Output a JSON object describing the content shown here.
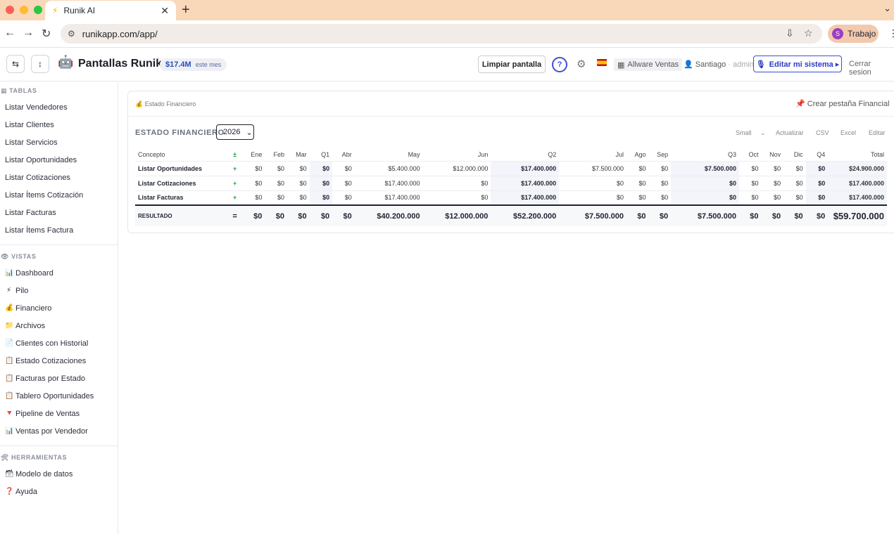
{
  "browser": {
    "tab_title": "Runik AI",
    "url": "runikapp.com/app/",
    "profile_initial": "S",
    "profile_label": "Trabajo"
  },
  "header": {
    "brand": "Pantallas Runik",
    "kpi_value": "$17.4M",
    "kpi_label": "este mes",
    "clear_label": "Limpiar pantalla",
    "help_label": "?",
    "company": "Allware Ventas",
    "user_name": "Santiago",
    "user_role": "· admin",
    "edit_label": "Editar mi sistema ▸",
    "logout_label": "Cerrar sesion"
  },
  "sidebar": {
    "tables_title": "TABLAS",
    "tables": [
      "Listar Vendedores",
      "Listar Clientes",
      "Listar Servicios",
      "Listar Oportunidades",
      "Listar Cotizaciones",
      "Listar Ítems Cotización",
      "Listar Facturas",
      "Listar Ítems Factura"
    ],
    "views_title": "VISTAS",
    "views": [
      {
        "label": "Dashboard",
        "icon": "📊"
      },
      {
        "label": "Pilo",
        "icon": "⚡"
      },
      {
        "label": "Financiero",
        "icon": "💰"
      },
      {
        "label": "Archivos",
        "icon": "📁"
      },
      {
        "label": "Clientes con Historial",
        "icon": "📄"
      },
      {
        "label": "Estado Cotizaciones",
        "icon": "📋"
      },
      {
        "label": "Facturas por Estado",
        "icon": "📋"
      },
      {
        "label": "Tablero Oportunidades",
        "icon": "📋"
      },
      {
        "label": "Pipeline de Ventas",
        "icon": "🔻"
      },
      {
        "label": "Ventas por Vendedor",
        "icon": "📊"
      }
    ],
    "tools_title": "HERRAMIENTAS",
    "tools": [
      {
        "label": "Modelo de datos",
        "icon": "🗃"
      },
      {
        "label": "Ayuda",
        "icon": "❓"
      }
    ]
  },
  "card": {
    "crumb": "💰 Estado Financiero",
    "create_tab": "Crear pestaña Financial",
    "title": "ESTADO FINANCIERO",
    "year": "2026",
    "size": "Small",
    "refresh": "Actualizar",
    "csv": "CSV",
    "excel": "Excel",
    "edit": "Editar"
  },
  "table": {
    "headers": [
      "Concepto",
      "±",
      "Ene",
      "Feb",
      "Mar",
      "Q1",
      "Abr",
      "May",
      "Jun",
      "Q2",
      "Jul",
      "Ago",
      "Sep",
      "Q3",
      "Oct",
      "Nov",
      "Dic",
      "Q4",
      "Total"
    ],
    "rows": [
      {
        "concept": "Listar Oportunidades",
        "sign": "+",
        "values": [
          "$0",
          "$0",
          "$0",
          "$0",
          "$0",
          "$5.400.000",
          "$12.000.000",
          "$17.400.000",
          "$7.500.000",
          "$0",
          "$0",
          "$7.500.000",
          "$0",
          "$0",
          "$0",
          "$0",
          "$24.900.000"
        ]
      },
      {
        "concept": "Listar Cotizaciones",
        "sign": "+",
        "values": [
          "$0",
          "$0",
          "$0",
          "$0",
          "$0",
          "$17.400.000",
          "$0",
          "$17.400.000",
          "$0",
          "$0",
          "$0",
          "$0",
          "$0",
          "$0",
          "$0",
          "$0",
          "$17.400.000"
        ]
      },
      {
        "concept": "Listar Facturas",
        "sign": "+",
        "values": [
          "$0",
          "$0",
          "$0",
          "$0",
          "$0",
          "$17.400.000",
          "$0",
          "$17.400.000",
          "$0",
          "$0",
          "$0",
          "$0",
          "$0",
          "$0",
          "$0",
          "$0",
          "$17.400.000"
        ]
      }
    ],
    "result": {
      "concept": "RESULTADO",
      "sign": "=",
      "values": [
        "$0",
        "$0",
        "$0",
        "$0",
        "$0",
        "$40.200.000",
        "$12.000.000",
        "$52.200.000",
        "$7.500.000",
        "$0",
        "$0",
        "$7.500.000",
        "$0",
        "$0",
        "$0",
        "$0",
        "$59.700.000"
      ]
    }
  }
}
